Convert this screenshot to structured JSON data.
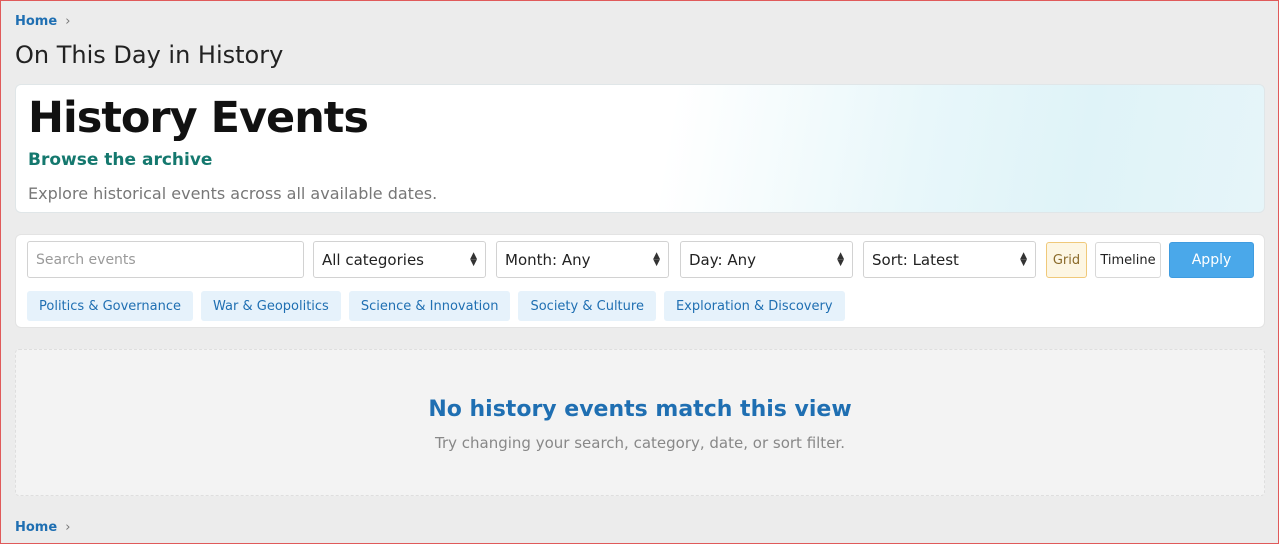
{
  "breadcrumb": {
    "home": "Home",
    "separator": "›"
  },
  "page": {
    "title": "On This Day in History"
  },
  "hero": {
    "title": "History Events",
    "subtitle": "Browse the archive",
    "description": "Explore historical events across all available dates."
  },
  "filters": {
    "search_placeholder": "Search events",
    "category": "All categories",
    "month": "Month: Any",
    "day": "Day: Any",
    "sort": "Sort: Latest",
    "grid_label": "Grid",
    "timeline_label": "Timeline",
    "apply_label": "Apply",
    "chips": [
      "Politics & Governance",
      "War & Geopolitics",
      "Science & Innovation",
      "Society & Culture",
      "Exploration & Discovery"
    ]
  },
  "empty_state": {
    "title": "No history events match this view",
    "description": "Try changing your search, category, date, or sort filter."
  },
  "colors": {
    "link": "#1f6fb2",
    "subtitle_teal": "#14786e",
    "apply_button": "#4aa8ea",
    "grid_active": "#fdf6e3",
    "chip_bg": "#e6f2fb"
  }
}
